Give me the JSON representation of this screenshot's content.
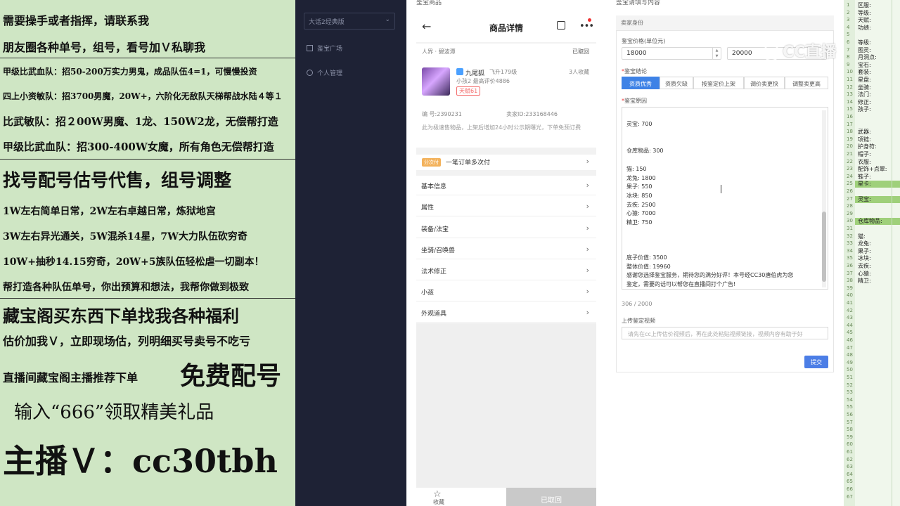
{
  "promo": {
    "lines": [
      "需要操手或者指挥，请联系我",
      "朋友圈各种单号，组号，看号加Ｖ私聊我",
      "甲级比武血队：招50-200万实力男鬼，成品队伍4=1，可慢慢投资",
      "四上小资敏队：招3700男魔，20W+，六阶化无敌队天梯帮战水陆４等１",
      "比武敏队：招２00W男魔、1龙、150W2龙，无偿帮打造",
      "甲级比武血队：招300-400W女魔，所有角色无偿帮打造",
      "找号配号估号代售，组号调整",
      "1W左右简单日常，2W左右卓越日常，炼狱地宫",
      "3W左右异光通关，5W混杀14星，7W大力队伍砍穷奇",
      "10W+抽秒14.15穷奇，20W+5族队伍轻松虐一切副本！",
      "帮打造各种队伍单号，你出预算和想法，我帮你做到极致",
      "藏宝阁买东西下单找我各种福利",
      "估价加我Ｖ，立即现场估，列明细买号卖号不吃亏",
      "直播间藏宝阁主播推荐下单",
      "免费配号",
      "输入“666”领取精美礼品",
      "主播Ｖ：cc30tbh"
    ]
  },
  "sidebar": {
    "version_select": "大话2经典版",
    "items": [
      "鉴宝广场",
      "个人管理"
    ]
  },
  "phone": {
    "title": "商品详情",
    "crumb": "人界 · 碧波潭",
    "status": "已取回",
    "pet": {
      "name": "九尾狐",
      "level": "飞升179级",
      "sub": "小孩2 最高评价4886",
      "badge": "天赋61",
      "fav_count": "3人收藏"
    },
    "id_left": "编 号:2390231",
    "id_right": "卖家ID:233168446",
    "notice": "此为极速售物品，上架后增加24小时公示期曝光，下单免预订费",
    "order_tag": "分次付",
    "order_text": "一笔订单多次付",
    "menu": [
      "基本信息",
      "属性",
      "装备/法宝",
      "坐骑/召唤兽",
      "法术修正",
      "小孩",
      "外观道具"
    ],
    "fav_label": "收藏",
    "revoked_btn": "已取回"
  },
  "appraisal": {
    "top_cut_left": "鉴宝商品",
    "top_cut_right": "鉴宝请填写内容",
    "seller_header": "卖家身份",
    "price_label": "鉴宝价格(单位元)",
    "price_min": "18000",
    "price_max": "20000",
    "conclusion_label": "鉴宝结论",
    "tabs": [
      "资质优秀",
      "资质欠缺",
      "按鉴定价上架",
      "调价卖更快",
      "调整卖更高"
    ],
    "reason_label": "鉴宝原因",
    "reason_lines": [
      "灵宝:     700",
      "",
      "仓库物品:     300",
      "",
      "猫:  150",
      "龙兔:     1800",
      "果子:     550",
      "冰块:     850",
      "去疾:     2500",
      "心猿:     7000",
      "精卫:     750",
      "",
      "底子价值:     3500",
      "整体价值:     19960",
      "感谢您选择鉴宝服务，期待您的满分好评！本号经CC30唐伯虎为您",
      "鉴定，需要的话可以帮您在直播间打个广告!"
    ],
    "char_count": "306 / 2000",
    "video_label": "上传鉴定视频",
    "video_placeholder": "请先在cc上传估价视频后，再在此处粘贴视频链接，视频内容有助于好",
    "submit": "提交"
  },
  "watermark": "CC直播",
  "strip": {
    "labels": [
      {
        "row": 0,
        "text": "区服:"
      },
      {
        "row": 1,
        "text": "等级:"
      },
      {
        "row": 2,
        "text": "天赋:"
      },
      {
        "row": 3,
        "text": "功绩:"
      },
      {
        "row": 5,
        "text": "等级:"
      },
      {
        "row": 6,
        "text": "图灵:"
      },
      {
        "row": 7,
        "text": "月洞点:"
      },
      {
        "row": 8,
        "text": "宝石:"
      },
      {
        "row": 9,
        "text": "套装:"
      },
      {
        "row": 10,
        "text": "星盘:"
      },
      {
        "row": 11,
        "text": "坐骑:"
      },
      {
        "row": 12,
        "text": "法门:"
      },
      {
        "row": 13,
        "text": "修正:"
      },
      {
        "row": 14,
        "text": "孩子:"
      },
      {
        "row": 17,
        "text": "武器:"
      },
      {
        "row": 18,
        "text": "项链:"
      },
      {
        "row": 19,
        "text": "护身符:"
      },
      {
        "row": 20,
        "text": "帽子:"
      },
      {
        "row": 21,
        "text": "衣服:"
      },
      {
        "row": 22,
        "text": "配饰+点翠:"
      },
      {
        "row": 23,
        "text": "鞋子:"
      },
      {
        "row": 24,
        "text": "星卡:"
      },
      {
        "row": 26,
        "text": "灵宝:"
      },
      {
        "row": 29,
        "text": "仓库物品:"
      },
      {
        "row": 31,
        "text": "猫:"
      },
      {
        "row": 32,
        "text": "龙兔:"
      },
      {
        "row": 33,
        "text": "果子:"
      },
      {
        "row": 34,
        "text": "冰块:"
      },
      {
        "row": 35,
        "text": "去疾:"
      },
      {
        "row": 36,
        "text": "心猿:"
      },
      {
        "row": 37,
        "text": "精卫:"
      }
    ],
    "highlight_rows": [
      24,
      26,
      29
    ]
  }
}
